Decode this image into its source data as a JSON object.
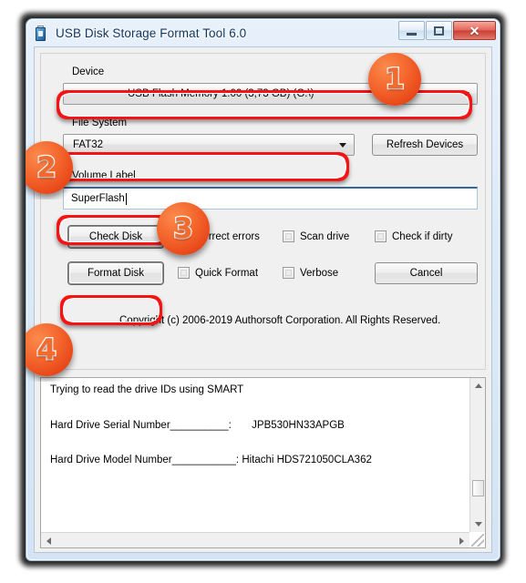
{
  "window": {
    "title": "USB Disk Storage Format Tool 6.0",
    "icon": "usb-flash-drive-icon",
    "controls": {
      "minimize": "minimize-button",
      "maximize": "maximize-button",
      "close": "close-button",
      "close_glyph": "✕"
    }
  },
  "form": {
    "device_label": "Device",
    "device_value": "USB Flash Memory  1.00 (3,73 GB) (G:\\)",
    "filesystem_label": "File System",
    "filesystem_value": "FAT32",
    "refresh_button": "Refresh Devices",
    "volume_label": "Volume Label",
    "volume_value": "SuperFlash",
    "check_disk_button": "Check Disk",
    "format_disk_button": "Format Disk",
    "cancel_button": "Cancel",
    "checkboxes": [
      {
        "label": "Correct errors",
        "checked": false
      },
      {
        "label": "Scan drive",
        "checked": false
      },
      {
        "label": "Check if dirty",
        "checked": false
      },
      {
        "label": "Quick Format",
        "checked": false
      },
      {
        "label": "Verbose",
        "checked": false
      }
    ],
    "copyright": "Copyright (c) 2006-2019 Authorsoft Corporation. All Rights Reserved."
  },
  "log": {
    "lines": [
      "Trying to read the drive IDs using SMART",
      "Hard Drive Serial Number__________:       JPB530HN33APGB",
      "Hard Drive Model Number___________: Hitachi HDS721050CLA362"
    ]
  },
  "annotations": {
    "badges": [
      {
        "number": "1",
        "target": "device-combo"
      },
      {
        "number": "2",
        "target": "filesystem-combo"
      },
      {
        "number": "3",
        "target": "volume-label-input"
      },
      {
        "number": "4",
        "target": "format-disk-button"
      }
    ],
    "highlight_color": "#f41414",
    "badge_color": "#f4662c"
  }
}
